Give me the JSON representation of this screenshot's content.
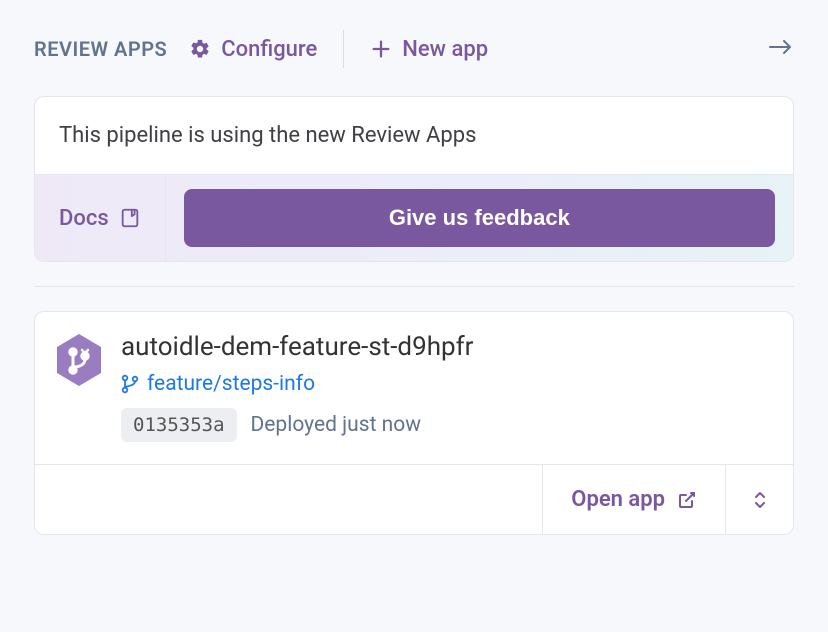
{
  "toolbar": {
    "title": "REVIEW APPS",
    "configure_label": "Configure",
    "new_app_label": "New app"
  },
  "notice": {
    "message": "This pipeline is using the new Review Apps",
    "docs_label": "Docs",
    "feedback_label": "Give us feedback"
  },
  "app": {
    "name": "autoidle-dem-feature-st-d9hpfr",
    "branch": "feature/steps-info",
    "commit": "0135353a",
    "deploy_status": "Deployed just now",
    "open_label": "Open app"
  }
}
